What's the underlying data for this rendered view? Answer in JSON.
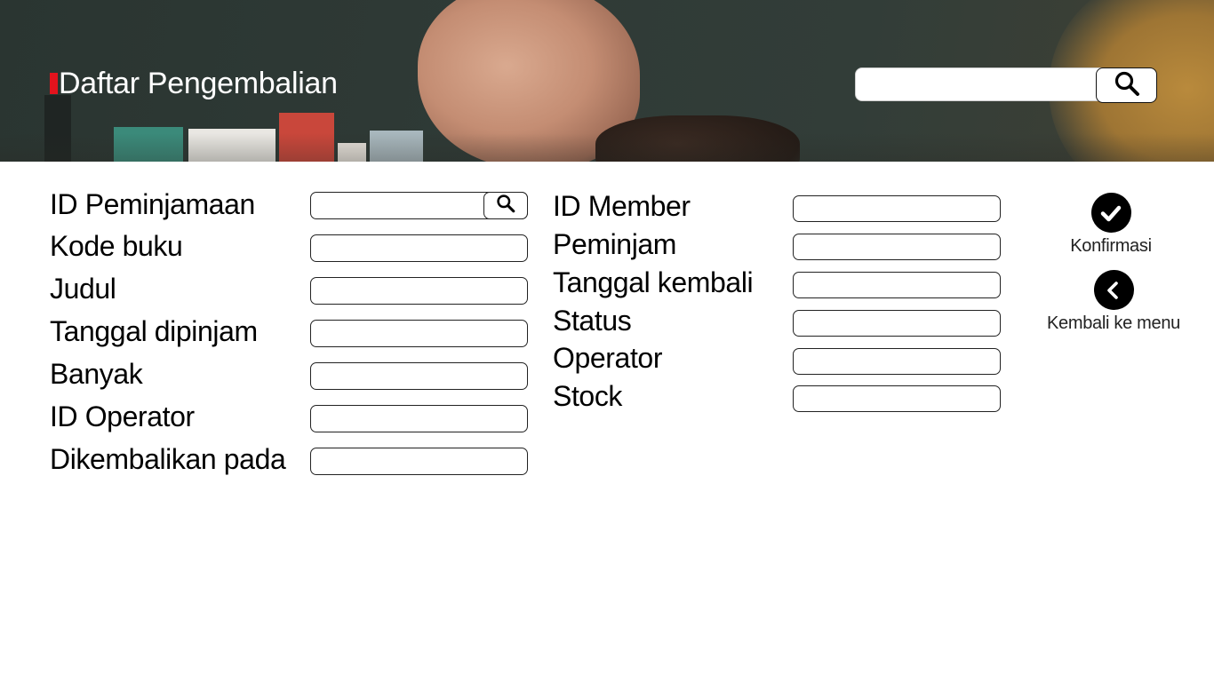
{
  "header": {
    "title": "Daftar Pengembalian",
    "search": {
      "value": "",
      "placeholder": ""
    },
    "search_icon": "search-icon",
    "accent_color": "#e3131d"
  },
  "form": {
    "left": [
      {
        "label": "ID Peminjamaan",
        "value": "",
        "has_search": true
      },
      {
        "label": "Kode buku",
        "value": ""
      },
      {
        "label": "Judul",
        "value": ""
      },
      {
        "label": "Tanggal dipinjam",
        "value": ""
      },
      {
        "label": "Banyak",
        "value": ""
      },
      {
        "label": "ID Operator",
        "value": ""
      },
      {
        "label": "Dikembalikan pada",
        "value": ""
      }
    ],
    "right": [
      {
        "label": "ID Member",
        "value": ""
      },
      {
        "label": "Peminjam",
        "value": ""
      },
      {
        "label": "Tanggal kembali",
        "value": ""
      },
      {
        "label": "Status",
        "value": ""
      },
      {
        "label": "Operator",
        "value": ""
      },
      {
        "label": "Stock",
        "value": ""
      }
    ]
  },
  "actions": {
    "confirm": {
      "label": "Konfirmasi",
      "icon": "check-icon"
    },
    "back": {
      "label": "Kembali ke menu",
      "icon": "chevron-left-icon"
    }
  }
}
